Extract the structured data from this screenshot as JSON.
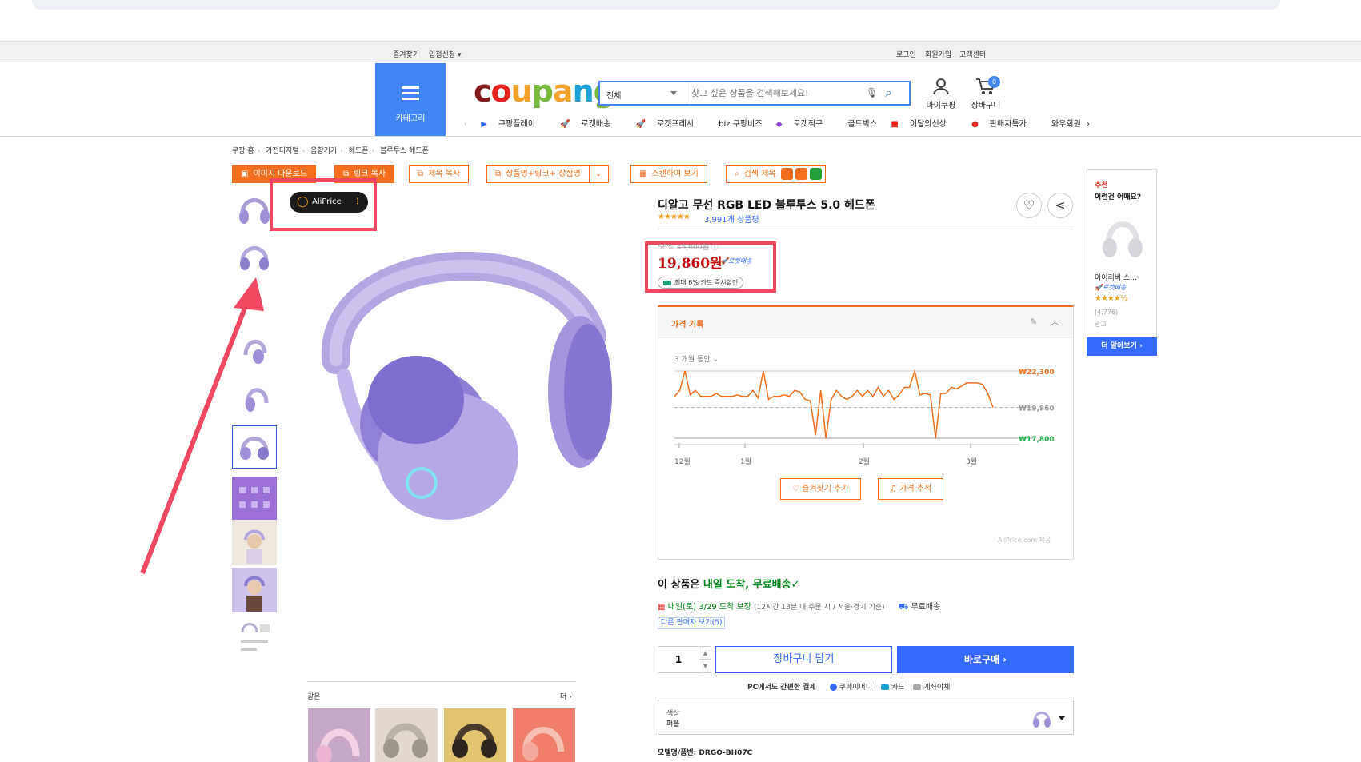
{
  "topbar": {
    "left": [
      "즐겨찾기",
      "입점신청 ▾"
    ],
    "right": [
      "로그인",
      "회원가입",
      "고객센터"
    ]
  },
  "header": {
    "category_label": "카테고리",
    "logo_text": "coupang",
    "search_category": "전체",
    "search_placeholder": "찾고 싶은 상품을 검색해보세요!",
    "mypage_label": "마이쿠팡",
    "cart_label": "장바구니",
    "cart_count": "0",
    "subnav": [
      "쿠팡플레이",
      "로켓배송",
      "로켓프레시",
      "biz 쿠팡비즈",
      "로켓직구",
      "골드박스",
      "이달의신상",
      "판매자특가",
      "와우회원"
    ]
  },
  "breadcrumb": [
    "쿠팡 홈",
    "가전디지털",
    "음향기기",
    "헤드폰",
    "블루투스 헤드폰"
  ],
  "toolbar": {
    "image_download": "이미지 다운로드",
    "link_copy": "링크 복사",
    "title_copy": "제목 복사",
    "product_link": "상품명+링크+ 상점명",
    "scan": "스캔하여 보기",
    "search_title": "검색 제목"
  },
  "aliprice": {
    "label": "AliPrice"
  },
  "product": {
    "title": "디알고 무선 RGB LED 블루투스 5.0 헤드폰",
    "stars": "★★★★★",
    "review_count": "3,991개 상품평",
    "discount": "56%",
    "old_price": "45,000원",
    "price": "19,860원",
    "rocket": "로켓배송",
    "card_discount": "최대 6% 카드 즉시할인"
  },
  "price_history": {
    "title": "가격 기록",
    "period": "3 개월 동안",
    "high": "₩22,300",
    "current": "₩19,860",
    "low": "₩17,800",
    "months": [
      "12월",
      "1월",
      "2월",
      "3월"
    ],
    "fav_button": "즐겨찾기 추가",
    "track_button": "가격 추적",
    "credit": "AliPrice.com 제공"
  },
  "delivery": {
    "title_prefix": "이 상품은 ",
    "title_green": "내일 도착, 무료배송",
    "check": "✓",
    "date": "내일(토) 3/29 도착 보장",
    "note": "(12시간 13분  내 주문 시 / 서울·경기 기준)",
    "free": "무료배송",
    "other_sellers": "다른 판매자 보기(5)"
  },
  "purchase": {
    "qty": "1",
    "cart_button": "장바구니 담기",
    "buy_button": "바로구매 ›",
    "pay_label": "PC에서도 간편한 결제",
    "pay_methods": [
      "쿠페이머니",
      "카드",
      "계좌이체"
    ]
  },
  "option": {
    "key": "색상",
    "value": "퍼플"
  },
  "model": "모델명/품번: DRGO-BH07C",
  "side": {
    "title1": "추천",
    "title2": "이런건 어때요?",
    "item_name": "아이리버 스...",
    "rocket": "로켓배송",
    "stars": "★★★★½",
    "count": "(4,776)",
    "ad": "광고",
    "more": "더 알아보기 ›"
  },
  "bottom": {
    "same_label": "같은",
    "more": "더 ›"
  },
  "colors": {
    "orange": "#f36f1e",
    "blue": "#346aff",
    "price_red": "#c50f0f",
    "annotation": "#f04763"
  },
  "chart_data": {
    "type": "line",
    "title": "가격 기록",
    "x": [
      "12월",
      "1월",
      "2월",
      "3월"
    ],
    "y_labels": [
      "₩22,300",
      "₩19,860",
      "₩17,800"
    ],
    "ylim": [
      17800,
      22300
    ],
    "series": [
      {
        "values": [
          20600,
          21000,
          22300,
          20700,
          21000,
          20600,
          20600,
          20600,
          20800,
          20600,
          20600,
          20600,
          20700,
          20600,
          20600,
          21000,
          20500,
          22300,
          20400,
          20600,
          20600,
          20700,
          20600,
          21000,
          20900,
          20400,
          20300,
          18000,
          21000,
          17800,
          20400,
          21000,
          20600,
          20400,
          20600,
          21000,
          20600,
          21000,
          20600,
          21200,
          20600,
          21000,
          20400,
          20700,
          21200,
          21200,
          22300,
          20700,
          20800,
          20700,
          17800,
          20800,
          20800,
          21200,
          21100,
          21300,
          21500,
          21500,
          21500,
          21400,
          20800,
          19860
        ]
      }
    ]
  }
}
